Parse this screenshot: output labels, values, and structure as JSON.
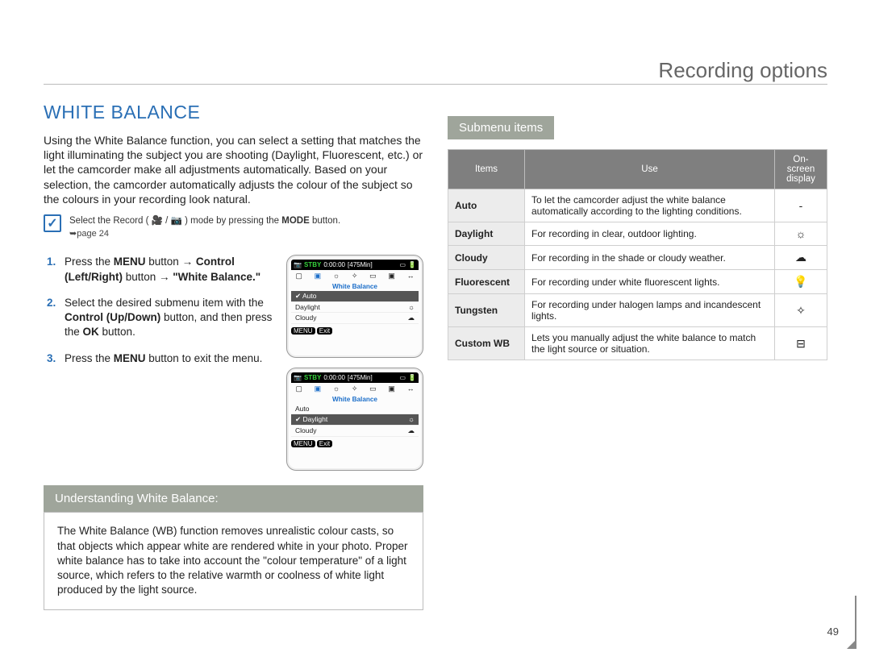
{
  "header": {
    "title": "Recording options"
  },
  "section_title": "WHITE BALANCE",
  "intro": "Using the White Balance function, you can select a setting that matches the light illuminating the subject you are shooting (Daylight, Fluorescent, etc.) or let the camcorder make all adjustments automatically. Based on your selection, the camcorder automatically adjusts the colour of the subject so the colours in your recording look natural.",
  "note": {
    "lead": "Select the Record (",
    "mid": " ) mode by pressing the ",
    "mode_word": "MODE",
    "tail": " button.",
    "sub": "➥page 24"
  },
  "steps": {
    "s1a": "Press the ",
    "s1b": "MENU",
    "s1c": " button → ",
    "s1d": "Control (Left/Right)",
    "s1e": " button → ",
    "s1f": "\"White Balance.\"",
    "s2a": "Select the desired submenu item with the ",
    "s2b": "Control (Up/Down)",
    "s2c": " button, and then press the ",
    "s2d": "OK",
    "s2e": " button.",
    "s3a": "Press the ",
    "s3b": "MENU",
    "s3c": " button to exit the menu."
  },
  "screenshot": {
    "stby": "STBY",
    "time": "0:00:00",
    "remain": "[475Min]",
    "wb_label": "White Balance",
    "rows1": [
      "Auto",
      "Daylight",
      "Cloudy"
    ],
    "rows2": [
      "Auto",
      "Daylight",
      "Cloudy"
    ],
    "menu": "MENU",
    "exit": "Exit"
  },
  "understanding": {
    "title": "Understanding White Balance:",
    "body": "The White Balance (WB) function removes unrealistic colour casts, so that objects which appear white are rendered white in your photo. Proper white balance has to take into account the \"colour temperature\" of a light source, which refers to the relative warmth or coolness of white light produced by the light source."
  },
  "submenu": {
    "title": "Submenu items",
    "headers": {
      "items": "Items",
      "use": "Use",
      "osd": "On-screen display"
    },
    "rows": [
      {
        "item": "Auto",
        "use": "To let the camcorder adjust the white balance automatically according to the lighting conditions.",
        "icon": "-"
      },
      {
        "item": "Daylight",
        "use": "For recording in clear, outdoor lighting.",
        "icon": "☼"
      },
      {
        "item": "Cloudy",
        "use": "For recording in the shade or cloudy weather.",
        "icon": "☁"
      },
      {
        "item": "Fluorescent",
        "use": "For recording under white fluorescent lights.",
        "icon": "💡"
      },
      {
        "item": "Tungsten",
        "use": "For recording under halogen lamps and incandescent lights.",
        "icon": "✧"
      },
      {
        "item": "Custom WB",
        "use": "Lets you manually adjust the white balance to match the light source or situation.",
        "icon": "⊟"
      }
    ]
  },
  "page_number": "49"
}
